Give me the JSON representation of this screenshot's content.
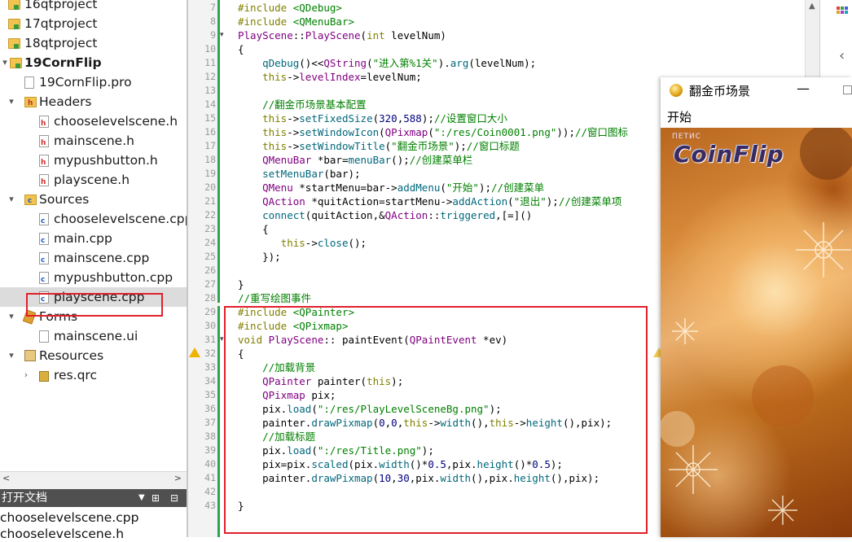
{
  "tree": {
    "items": [
      {
        "label": "16qtproject",
        "icon": "project-folder-icon",
        "bold": false,
        "arrow": ""
      },
      {
        "label": "17qtproject",
        "icon": "project-folder-icon",
        "bold": false,
        "arrow": ""
      },
      {
        "label": "18qtproject",
        "icon": "project-folder-icon",
        "bold": false,
        "arrow": ""
      },
      {
        "label": "19CornFlip",
        "icon": "project-folder-icon",
        "bold": true,
        "arrow": "▾"
      },
      {
        "label": "19CornFlip.pro",
        "icon": "pro-file-icon",
        "bold": false,
        "arrow": ""
      },
      {
        "label": "Headers",
        "icon": "headers-folder-icon",
        "bold": false,
        "arrow": "▾"
      },
      {
        "label": "chooselevelscene.h",
        "icon": "header-file-icon",
        "bold": false,
        "arrow": ""
      },
      {
        "label": "mainscene.h",
        "icon": "header-file-icon",
        "bold": false,
        "arrow": ""
      },
      {
        "label": "mypushbutton.h",
        "icon": "header-file-icon",
        "bold": false,
        "arrow": ""
      },
      {
        "label": "playscene.h",
        "icon": "header-file-icon",
        "bold": false,
        "arrow": ""
      },
      {
        "label": "Sources",
        "icon": "sources-folder-icon",
        "bold": false,
        "arrow": "▾"
      },
      {
        "label": "chooselevelscene.cpp",
        "icon": "cpp-file-icon",
        "bold": false,
        "arrow": ""
      },
      {
        "label": "main.cpp",
        "icon": "cpp-file-icon",
        "bold": false,
        "arrow": ""
      },
      {
        "label": "mainscene.cpp",
        "icon": "cpp-file-icon",
        "bold": false,
        "arrow": ""
      },
      {
        "label": "mypushbutton.cpp",
        "icon": "cpp-file-icon",
        "bold": false,
        "arrow": ""
      },
      {
        "label": "playscene.cpp",
        "icon": "cpp-file-icon",
        "bold": false,
        "arrow": "",
        "selected": true
      },
      {
        "label": "Forms",
        "icon": "forms-folder-icon",
        "bold": false,
        "arrow": "▾"
      },
      {
        "label": "mainscene.ui",
        "icon": "ui-file-icon",
        "bold": false,
        "arrow": ""
      },
      {
        "label": "Resources",
        "icon": "resources-folder-icon",
        "bold": false,
        "arrow": "▾"
      },
      {
        "label": "res.qrc",
        "icon": "qrc-file-icon",
        "bold": false,
        "arrow": "›"
      }
    ]
  },
  "open_docs": {
    "title": "打开文档",
    "items": [
      "chooselevelscene.cpp",
      "chooselevelscene.h"
    ]
  },
  "editor": {
    "line_numbers": [
      "7",
      "8",
      "9",
      "10",
      "11",
      "12",
      "13",
      "14",
      "15",
      "16",
      "17",
      "18",
      "19",
      "20",
      "21",
      "22",
      "23",
      "24",
      "25",
      "26",
      "27",
      "28",
      "29",
      "30",
      "31",
      "32",
      "33",
      "34",
      "35",
      "36",
      "37",
      "38",
      "39",
      "40",
      "41",
      "42",
      "43"
    ],
    "lines": [
      "#include <QDebug>",
      "#include <QMenuBar>",
      "PlayScene::PlayScene(int levelNum)",
      "{",
      "    qDebug()<<QString(\"进入第%1关\").arg(levelNum);",
      "    this->levelIndex=levelNum;",
      "",
      "    //翻金币场景基本配置",
      "    this->setFixedSize(320,588);//设置窗口大小",
      "    this->setWindowIcon(QPixmap(\":/res/Coin0001.png\"));//窗口图标",
      "    this->setWindowTitle(\"翻金币场景\");//窗口标题",
      "    QMenuBar *bar=menuBar();//创建菜单栏",
      "    setMenuBar(bar);",
      "    QMenu *startMenu=bar->addMenu(\"开始\");//创建菜单",
      "    QAction *quitAction=startMenu->addAction(\"退出\");//创建菜单项",
      "    connect(quitAction,&QAction::triggered,[=]()",
      "    {",
      "       this->close();",
      "    });",
      "",
      "}",
      "//重写绘图事件",
      "#include <QPainter>",
      "#include <QPixmap>",
      "void PlayScene:: paintEvent(QPaintEvent *ev)",
      "{",
      "    //加载背景",
      "    QPainter painter(this);",
      "    QPixmap pix;",
      "    pix.load(\":/res/PlayLevelSceneBg.png\");",
      "    painter.drawPixmap(0,0,this->width(),this->height(),pix);",
      "    //加载标题",
      "    pix.load(\":/res/Title.png\");",
      "    pix=pix.scaled(pix.width()*0.5,pix.height()*0.5);",
      "    painter.drawPixmap(10,30,pix.width(),pix.height(),pix);",
      "",
      "}"
    ]
  },
  "window": {
    "title": "翻金币场景",
    "menu": "开始",
    "logo": "CoinFlip",
    "logo_sub": "ПЕТИС",
    "minimize_glyph": "—"
  },
  "accent": {
    "highlight_border": "#e0202a",
    "warning": "#f0b400"
  }
}
